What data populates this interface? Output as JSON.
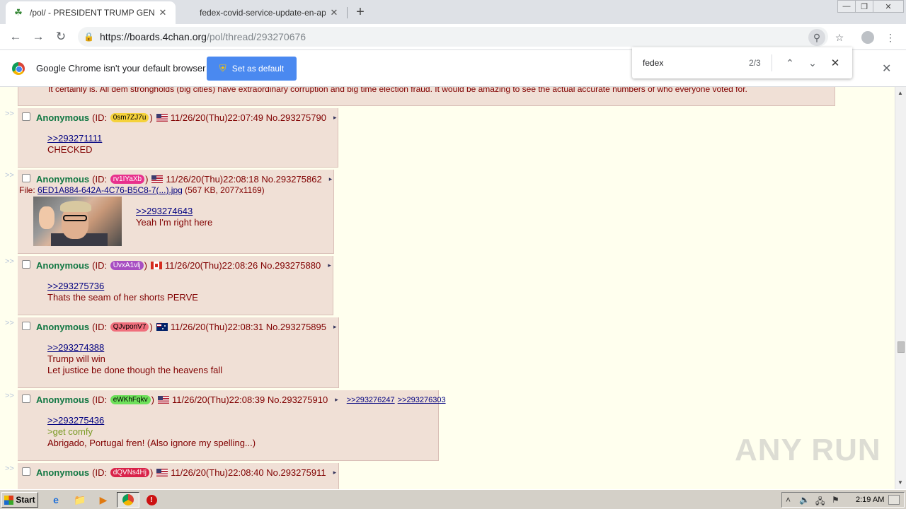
{
  "browser": {
    "tabs": [
      {
        "title": "/pol/ - PRESIDENT TRUMP GENERAL",
        "active": true
      },
      {
        "title": "fedex-covid-service-update-en-apac",
        "active": false
      }
    ],
    "url_host": "https://boards.4chan.org",
    "url_path": "/pol/thread/293270676",
    "infobar": {
      "message": "Google Chrome isn't your default browser",
      "button": "Set as default"
    },
    "find": {
      "query": "fedex",
      "count": "2/3"
    }
  },
  "thread": {
    "previous_text": "It certainly is. All dem strongholds (big cities) have extraordinary corruption and big time election fraud. It would be amazing to see the actual accurate numbers of who everyone voted for.",
    "arrows": ">>",
    "posts": [
      {
        "name": "Anonymous",
        "id_prefix": "(ID:",
        "id": "0sm7ZJ7u",
        "id_color": "#f5d23b",
        "id_text_color": "#000000",
        "id_suffix": ")",
        "flag": "us-flag",
        "datetime": "11/26/20(Thu)22:07:49",
        "number": "No.293275790",
        "lines": [
          {
            "type": "quotelink",
            "text": ">>293271111"
          },
          {
            "type": "text",
            "text": "CHECKED"
          }
        ]
      },
      {
        "name": "Anonymous",
        "id_prefix": "(ID:",
        "id": "rv1IYaXb",
        "id_color": "#e8318d",
        "id_text_color": "#ffffff",
        "id_suffix": ")",
        "flag": "us-flag",
        "datetime": "11/26/20(Thu)22:08:18",
        "number": "No.293275862",
        "file_prefix": "File:",
        "file_name": "6ED1A884-642A-4C76-B5C8-7(...).jpg",
        "file_meta": "(567 KB, 2077x1169)",
        "lines": [
          {
            "type": "quotelink",
            "text": ">>293274643"
          },
          {
            "type": "text",
            "text": "Yeah I'm right here"
          }
        ]
      },
      {
        "name": "Anonymous",
        "id_prefix": "(ID:",
        "id": "UvxA1vlj",
        "id_color": "#a84fc2",
        "id_text_color": "#ffffff",
        "id_suffix": ")",
        "flag": "ca-flag",
        "datetime": "11/26/20(Thu)22:08:26",
        "number": "No.293275880",
        "lines": [
          {
            "type": "quotelink",
            "text": ">>293275736"
          },
          {
            "type": "text",
            "text": "Thats the seam of her shorts PERVE"
          }
        ]
      },
      {
        "name": "Anonymous",
        "id_prefix": "(ID:",
        "id": "QJvponV7",
        "id_color": "#f06e7c",
        "id_text_color": "#000000",
        "id_suffix": ")",
        "flag": "au-flag",
        "datetime": "11/26/20(Thu)22:08:31",
        "number": "No.293275895",
        "lines": [
          {
            "type": "quotelink",
            "text": ">>293274388"
          },
          {
            "type": "text",
            "text": "Trump will win"
          },
          {
            "type": "text",
            "text": "Let justice be done though the heavens fall"
          }
        ]
      },
      {
        "name": "Anonymous",
        "id_prefix": "(ID:",
        "id": "eWKhFqkv",
        "id_color": "#6ee05a",
        "id_text_color": "#000000",
        "id_suffix": ")",
        "flag": "us-flag",
        "datetime": "11/26/20(Thu)22:08:39",
        "number": "No.293275910",
        "backlinks": [
          ">>293276247",
          ">>293276303"
        ],
        "lines": [
          {
            "type": "quotelink",
            "text": ">>293275436"
          },
          {
            "type": "greentext",
            "text": ">get comfy"
          },
          {
            "type": "text",
            "text": "Abrigado, Portugal fren! (Also ignore my spelling...)"
          }
        ]
      },
      {
        "name": "Anonymous",
        "id_prefix": "(ID:",
        "id": "dQVNs4Hj",
        "id_color": "#d9234a",
        "id_text_color": "#ffffff",
        "id_suffix": ")",
        "flag": "us-flag",
        "datetime": "11/26/20(Thu)22:08:40",
        "number": "No.293275911",
        "lines": []
      }
    ]
  },
  "watermark": "ANY RUN",
  "taskbar": {
    "start_label": "Start",
    "clock": "2:19 AM"
  }
}
